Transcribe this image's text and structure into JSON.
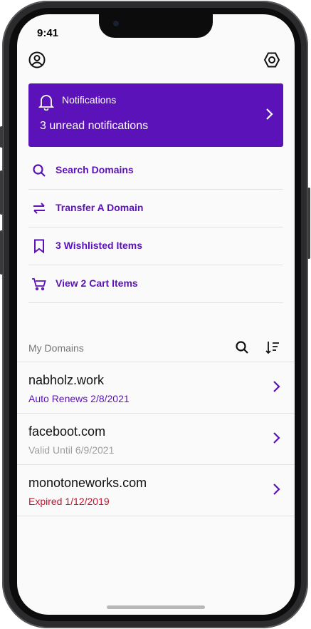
{
  "status_bar": {
    "time": "9:41"
  },
  "header": {
    "profile_icon": "user-circle-icon",
    "settings_icon": "hex-gear-icon"
  },
  "notifications": {
    "title": "Notifications",
    "subtitle": "3 unread notifications"
  },
  "menu": [
    {
      "label": "Search Domains",
      "icon": "search-icon"
    },
    {
      "label": "Transfer A Domain",
      "icon": "transfer-arrows-icon"
    },
    {
      "label": "3 Wishlisted Items",
      "icon": "bookmark-icon"
    },
    {
      "label": "View 2 Cart Items",
      "icon": "cart-icon"
    }
  ],
  "my_domains": {
    "title": "My Domains",
    "items": [
      {
        "name": "nabholz.work",
        "status": "Auto Renews 2/8/2021",
        "status_color": "#5b12b8"
      },
      {
        "name": "faceboot.com",
        "status": "Valid Until 6/9/2021",
        "status_color": "#9e9e9e"
      },
      {
        "name": "monotoneworks.com",
        "status": "Expired 1/12/2019",
        "status_color": "#c8102e"
      }
    ]
  },
  "colors": {
    "accent": "#5b12b8",
    "expired": "#c8102e",
    "muted": "#9e9e9e"
  }
}
